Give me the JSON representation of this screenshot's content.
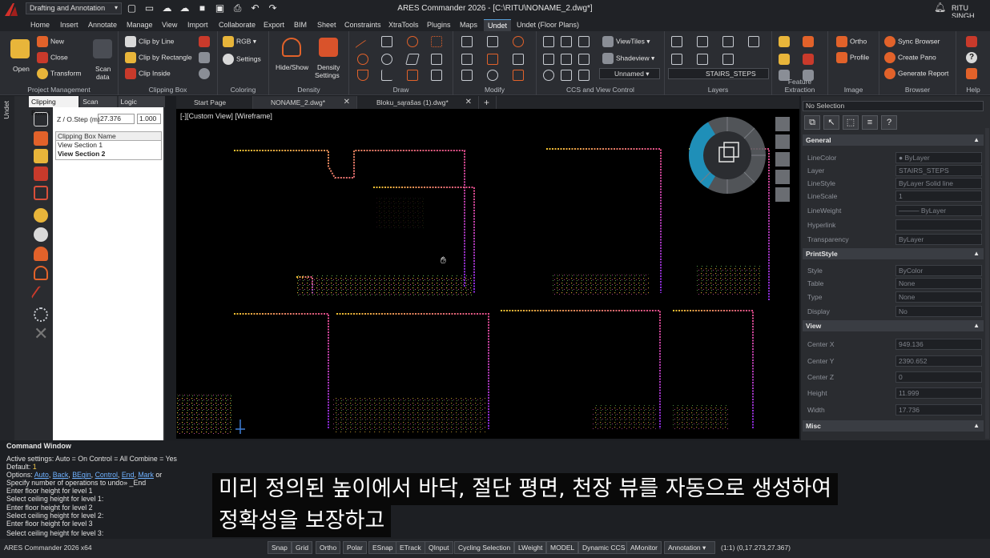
{
  "titlebar": {
    "workspace": "Drafting and Annotation",
    "title": "ARES Commander 2026 - [C:\\RITU\\NONAME_2.dwg*]",
    "user": "RITU SINGH",
    "qat_icons": [
      "new-file-icon",
      "open-folder-icon",
      "cloud-open-icon",
      "cloud-save-icon",
      "save-icon",
      "save-as-icon",
      "print-icon",
      "undo-icon",
      "redo-icon"
    ]
  },
  "tabs": [
    "Home",
    "Insert",
    "Annotate",
    "Manage",
    "View",
    "Import",
    "Collaborate",
    "Export",
    "BIM",
    "Sheet",
    "Constraints",
    "XtraTools",
    "Plugins",
    "Maps",
    "Undet",
    "Undet (Floor Plans)"
  ],
  "active_tab": "Undet",
  "ribbon": {
    "project": {
      "title": "Project Management",
      "open": "Open",
      "new": "New",
      "close": "Close",
      "transform": "Transform",
      "scan": "Scan",
      "scan2": "data"
    },
    "clip": {
      "title": "Clipping Box",
      "line": "Clip by Line",
      "rect": "Clip by Rectangle",
      "inside": "Clip Inside"
    },
    "color": {
      "title": "Coloring",
      "rgb": "RGB",
      "settings": "Settings"
    },
    "density": {
      "title": "Density",
      "hide": "Hide/Show",
      "settings1": "Density",
      "settings2": "Settings"
    },
    "draw": {
      "title": "Draw"
    },
    "modify": {
      "title": "Modify"
    },
    "ccs": {
      "title": "CCS and View Control",
      "viewtiles": "ViewTiles",
      "shadeview": "Shadeview",
      "named": "Unnamed"
    },
    "layers": {
      "title": "Layers",
      "current": "STAIRS_STEPS"
    },
    "feature": {
      "title": "Feature Extraction"
    },
    "image": {
      "title": "Image",
      "ortho": "Ortho",
      "profile": "Profile"
    },
    "browser": {
      "title": "Browser",
      "sync": "Sync Browser",
      "pano": "Create Pano",
      "report": "Generate Report"
    },
    "help": {
      "title": "Help"
    }
  },
  "left_vtab": "Undet",
  "undet_panel": {
    "tabs": [
      "Clipping Boxes",
      "Scan Data",
      "Logic Classes"
    ],
    "z_label": "Z / O.Step (m)",
    "z_value": "27.376",
    "z_step": "1.000",
    "list_header": "Clipping Box Name",
    "items": [
      "View Section 1",
      "View Section 2"
    ]
  },
  "doc_tabs": [
    "Start Page",
    "NONAME_2.dwg*",
    "Bloku_sąrašas (1).dwg*"
  ],
  "viewport": {
    "label": "[-][Custom View] [Wireframe]"
  },
  "properties": {
    "selection": "No Selection",
    "sections": {
      "general": "General",
      "printstyle": "PrintStyle",
      "view": "View",
      "misc": "Misc"
    },
    "general": [
      {
        "k": "LineColor",
        "v": "● ByLayer"
      },
      {
        "k": "Layer",
        "v": "STAIRS_STEPS"
      },
      {
        "k": "LineStyle",
        "v": "ByLayer     Solid line"
      },
      {
        "k": "LineScale",
        "v": "1"
      },
      {
        "k": "LineWeight",
        "v": "——— ByLayer"
      },
      {
        "k": "Hyperlink",
        "v": ""
      },
      {
        "k": "Transparency",
        "v": "ByLayer"
      }
    ],
    "printstyle": [
      {
        "k": "Style",
        "v": "ByColor"
      },
      {
        "k": "Table",
        "v": "None"
      },
      {
        "k": "Type",
        "v": "None"
      },
      {
        "k": "Display",
        "v": "No"
      }
    ],
    "view": [
      {
        "k": "Center X",
        "v": "949.136"
      },
      {
        "k": "Center Y",
        "v": "2390.652"
      },
      {
        "k": "Center Z",
        "v": "0"
      },
      {
        "k": "Height",
        "v": "11.999"
      },
      {
        "k": "Width",
        "v": "17.736"
      }
    ]
  },
  "command": {
    "title": "Command Window",
    "l1": "Active settings: Auto = On Control = All Combine = Yes",
    "l2a": "Default: ",
    "l2b": "1",
    "l3a": "Options: ",
    "o1": "Auto",
    "o2": "Back",
    "o3": "BEgin",
    "o4": "Control",
    "o5": "End",
    "o6": "Mark",
    "l3b": " or",
    "l4": "Specify number of operations to undo» _End",
    "l5": "Enter floor height for level 1",
    "l6": "Select ceiling height for level 1:",
    "l7": "Enter floor height for level 2",
    "l8": "Select ceiling height for level 2:",
    "l9": "Enter floor height for level 3",
    "l10": "Select ceiling height for level 3:"
  },
  "subtitles": {
    "line1": "미리 정의된 높이에서 바닥, 절단 평면, 천장 뷰를 자동으로 생성하여",
    "line2": "정확성을 보장하고"
  },
  "status": {
    "app": "ARES Commander 2026 x64",
    "buttons": [
      "Snap",
      "Grid",
      "Ortho",
      "Polar",
      "ESnap",
      "ETrack",
      "QInput",
      "Cycling Selection",
      "LWeight",
      "MODEL",
      "Dynamic CCS",
      "AMonitor",
      "Annotation"
    ],
    "scale": "(1:1)",
    "coords": "(0,17.273,27.367)"
  },
  "colors": {
    "accent": "#e2622a",
    "tab_border": "#58a0d8",
    "wheel": "#1f8fb8"
  }
}
